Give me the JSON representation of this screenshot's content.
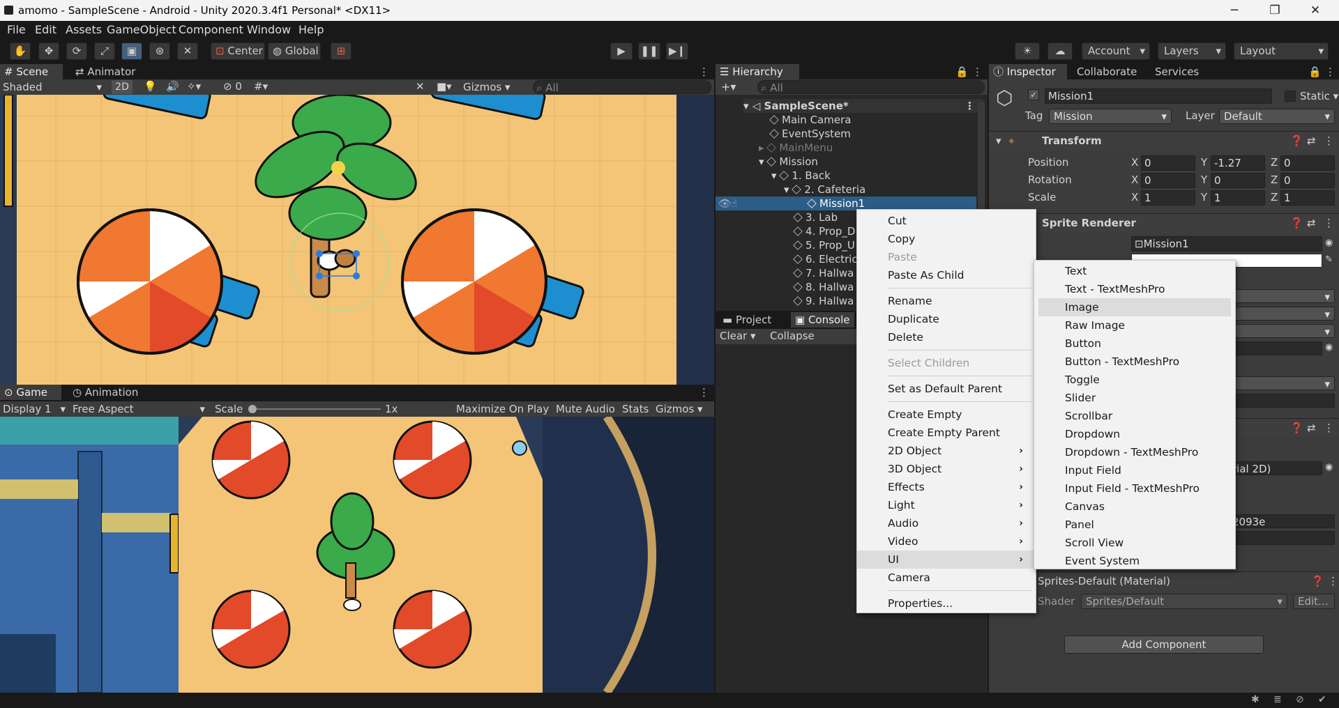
{
  "window": {
    "title": "amomo - SampleScene - Android - Unity 2020.3.4f1 Personal* <DX11>",
    "min": "─",
    "max": "❐",
    "close": "✕"
  },
  "menu": [
    "File",
    "Edit",
    "Assets",
    "GameObject",
    "Component",
    "Window",
    "Help"
  ],
  "toolbar": {
    "center": "Center",
    "global": "Global",
    "account": "Account",
    "layers": "Layers",
    "layout": "Layout"
  },
  "scene": {
    "tab_scene": "Scene",
    "tab_animator": "Animator",
    "shaded": "Shaded",
    "twod": "2D",
    "hidden_count": "0",
    "gizmos": "Gizmos",
    "search": "All"
  },
  "game": {
    "tab_game": "Game",
    "tab_animation": "Animation",
    "display": "Display 1",
    "aspect": "Free Aspect",
    "scale_label": "Scale",
    "scale_value": "1x",
    "maximize": "Maximize On Play",
    "mute": "Mute Audio",
    "stats": "Stats",
    "gizmos": "Gizmos"
  },
  "hierarchy": {
    "tab": "Hierarchy",
    "search": "All",
    "scene": "SampleScene*",
    "items": [
      "Main Camera",
      "EventSystem",
      "MainMenu",
      "Mission",
      "1. Back",
      "2. Cafeteria",
      "Mission1",
      "3. Lab",
      "4. Prop_D",
      "5. Prop_U",
      "6. Electric",
      "7. Hallwa",
      "8. Hallwa",
      "9. Hallwa"
    ]
  },
  "project": {
    "tab_project": "Project",
    "tab_console": "Console",
    "clear": "Clear",
    "collapse": "Collapse"
  },
  "inspector": {
    "tab_inspector": "Inspector",
    "tab_collab": "Collaborate",
    "tab_services": "Services",
    "name": "Mission1",
    "static": "Static",
    "tag_label": "Tag",
    "tag": "Mission",
    "layer_label": "Layer",
    "layer": "Default",
    "transform": "Transform",
    "position": "Position",
    "rotation": "Rotation",
    "scale": "Scale",
    "x": "X",
    "y": "Y",
    "z": "Z",
    "pos": [
      "0",
      "-1.27",
      "0"
    ],
    "rot": [
      "0",
      "0",
      "0"
    ],
    "scl": [
      "1",
      "1",
      "1"
    ],
    "sprite_renderer": "Sprite Renderer",
    "sprite": "Mission1",
    "material_partial": "rial 2D)",
    "hex_partial": "2093e",
    "material": "Sprites-Default (Material)",
    "shader_label": "Shader",
    "shader": "Sprites/Default",
    "edit": "Edit...",
    "add_component": "Add Component"
  },
  "context_menu": [
    "Cut",
    "Copy",
    "Paste",
    "Paste As Child",
    "Rename",
    "Duplicate",
    "Delete",
    "Select Children",
    "Set as Default Parent",
    "Create Empty",
    "Create Empty Parent",
    "2D Object",
    "3D Object",
    "Effects",
    "Light",
    "Audio",
    "Video",
    "UI",
    "Camera",
    "Properties..."
  ],
  "ui_submenu": [
    "Text",
    "Text - TextMeshPro",
    "Image",
    "Raw Image",
    "Button",
    "Button - TextMeshPro",
    "Toggle",
    "Slider",
    "Scrollbar",
    "Dropdown",
    "Dropdown - TextMeshPro",
    "Input Field",
    "Input Field - TextMeshPro",
    "Canvas",
    "Panel",
    "Scroll View",
    "Event System"
  ]
}
